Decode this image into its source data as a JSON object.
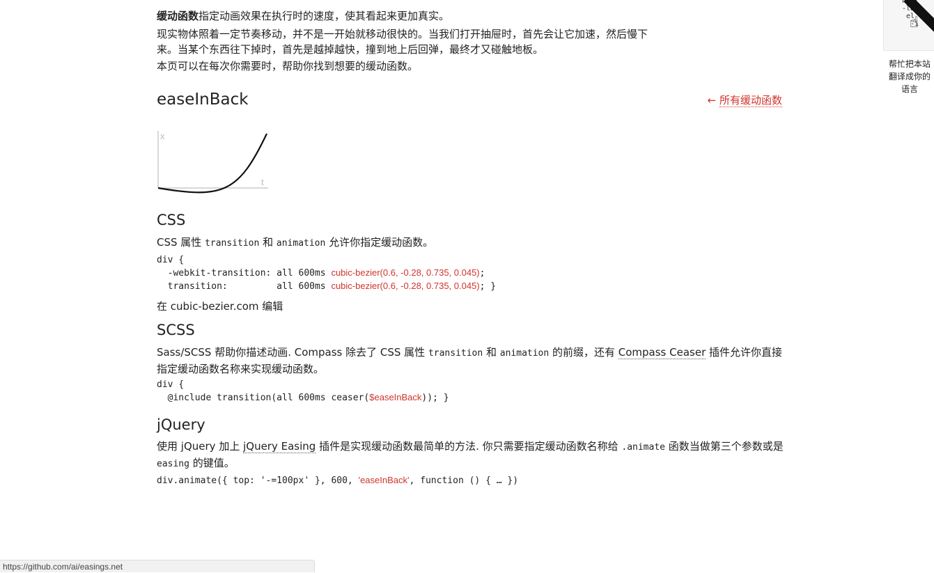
{
  "intro": {
    "bold": "缓动函数",
    "line1_rest": "指定动画效果在执行时的速度，使其看起来更加真实。",
    "line2": "现实物体照着一定节奏移动，并不是一开始就移动很快的。当我们打开抽屉时，首先会让它加速，然后慢下来。当某个东西往下掉时，首先是越掉越快，撞到地上后回弹，最终才又碰触地板。",
    "line3": "本页可以在每次你需要时，帮助你找到想要的缓动函数。"
  },
  "title": "easeInBack",
  "all_link": {
    "arrow": "←",
    "label": "所有缓动函数"
  },
  "graph": {
    "x_label": "x",
    "t_label": "t"
  },
  "css": {
    "heading": "CSS",
    "desc_a": "CSS 属性 ",
    "desc_code1": "transition",
    "desc_b": " 和 ",
    "desc_code2": "animation",
    "desc_c": " 允许你指定缓动函数。",
    "code_l1": "div {",
    "code_l2a": "  -webkit-transition: all 600ms ",
    "code_l2b": "cubic-bezier(0.6, -0.28, 0.735, 0.045)",
    "code_l2c": ";",
    "code_l3a": "  transition:         all 600ms ",
    "code_l3b": "cubic-bezier(0.6, -0.28, 0.735, 0.045)",
    "code_l3c": "; }",
    "edit_a": "在 ",
    "edit_link": "cubic-bezier.com",
    "edit_b": " 编辑"
  },
  "scss": {
    "heading": "SCSS",
    "desc_a": "Sass/SCSS 帮助你描述动画. Compass 除去了 CSS 属性 ",
    "desc_code1": "transition",
    "desc_b": " 和 ",
    "desc_code2": "animation",
    "desc_c": " 的前缀，还有 ",
    "desc_link": "Compass Ceaser",
    "desc_d": " 插件允许你直接指定缓动函数名称来实现缓动函数。",
    "code_l1": "div {",
    "code_l2a": "  @include transition(all 600ms ceaser(",
    "code_l2b": "$easeInBack",
    "code_l2c": ")); }"
  },
  "jquery": {
    "heading": "jQuery",
    "desc_a": "使用 ",
    "desc_link1": "jQuery",
    "desc_b": " 加上 ",
    "desc_link2": "jQuery Easing",
    "desc_c": " 插件是实现缓动函数最简单的方法. 你只需要指定缓动函数名称给 ",
    "desc_code1": ".animate",
    "desc_d": " 函数当做第三个参数或是 ",
    "desc_code2": "easing",
    "desc_e": " 的键值。",
    "code_a": "div.animate({ top: '-=100px' }, 600, ",
    "code_b": "'easeInBack'",
    "code_c": ", function () { … })"
  },
  "ribbon": {
    "code_text": "html\n-lata\n el\n  -i",
    "help_text": "帮忙把本站翻译成你的语言"
  },
  "status_bar": {
    "url": "https://github.com/ai/easings.net"
  }
}
